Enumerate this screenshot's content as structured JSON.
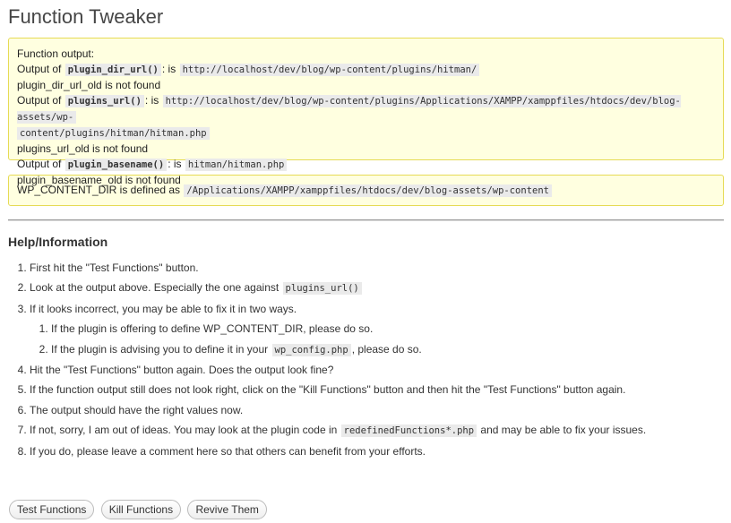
{
  "page": {
    "title": "Function Tweaker"
  },
  "output": {
    "heading": "Function output:",
    "lines": [
      {
        "prefix": "Output of",
        "func": "plugin_dir_url()",
        "mid": ": is",
        "value": "http://localhost/dev/blog/wp-content/plugins/hitman/"
      },
      {
        "text": "plugin_dir_url_old is not found"
      },
      {
        "prefix": "Output of",
        "func": "plugins_url()",
        "mid": ": is",
        "value": "http://localhost/dev/blog/wp-content/plugins/Applications/XAMPP/xamppfiles/htdocs/dev/blog-assets/wp-",
        "value_cont": "content/plugins/hitman/hitman.php"
      },
      {
        "text": "plugins_url_old is not found"
      },
      {
        "prefix": "Output of",
        "func": "plugin_basename()",
        "mid": ": is",
        "value": "hitman/hitman.php"
      },
      {
        "text": "plugin_basename_old is not found"
      }
    ]
  },
  "wpcontent": {
    "label": "WP_CONTENT_DIR is defined as",
    "value": "/Applications/XAMPP/xamppfiles/htdocs/dev/blog-assets/wp-content"
  },
  "help": {
    "heading": "Help/Information",
    "steps": [
      {
        "text": "First hit the \"Test Functions\" button."
      },
      {
        "text": "Look at the output above. Especially the one against",
        "code": "plugins_url()"
      },
      {
        "text": "If it looks incorrect, you may be able to fix it in two ways."
      },
      {
        "text": "Hit the \"Test Functions\" button again. Does the output look fine?"
      },
      {
        "text": "If the function output still does not look right, click on the \"Kill Functions\" button and then hit the \"Test Functions\" button again."
      },
      {
        "text": "The output should have the right values now."
      },
      {
        "text": "If not, sorry, I am out of ideas. You may look at the plugin code in",
        "code": "redefinedFunctions*.php",
        "after": "and may be able to fix your issues."
      },
      {
        "text": "If you do, please leave a comment here so that others can benefit from your efforts."
      }
    ],
    "substeps": [
      {
        "text": "If the plugin is offering to define WP_CONTENT_DIR, please do so."
      },
      {
        "text": "If the plugin is advising you to define it in your",
        "code": "wp_config.php",
        "after": ", please do so."
      }
    ]
  },
  "buttons": {
    "test": "Test Functions",
    "kill": "Kill Functions",
    "revive": "Revive Them"
  }
}
